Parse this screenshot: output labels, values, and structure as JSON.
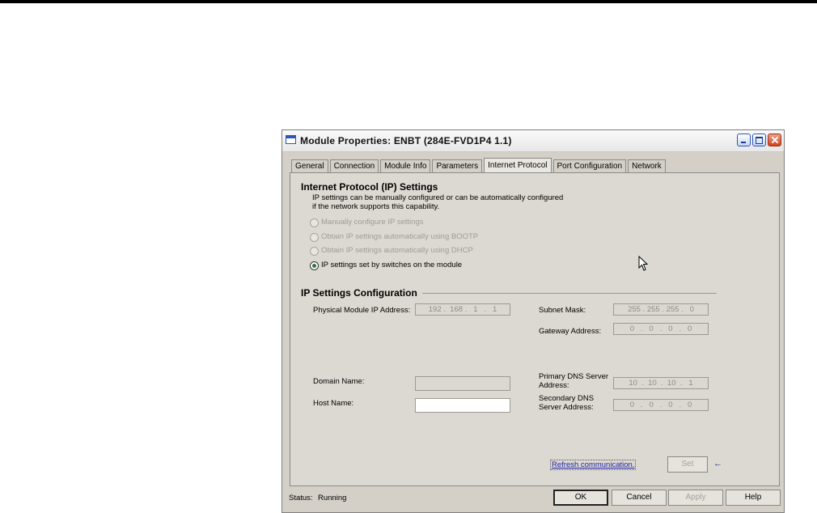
{
  "window": {
    "title": "Module Properties: ENBT (284E-FVD1P4 1.1)"
  },
  "tabs": [
    "General",
    "Connection",
    "Module Info",
    "Parameters",
    "Internet Protocol",
    "Port Configuration",
    "Network"
  ],
  "active_tab": "Internet Protocol",
  "ip_settings": {
    "heading": "Internet Protocol (IP) Settings",
    "desc_line1": "IP settings can be manually configured or can be automatically configured",
    "desc_line2": "if the network supports this capability.",
    "options": [
      {
        "label": "Manually configure IP settings",
        "selected": false,
        "enabled": false
      },
      {
        "label": "Obtain IP settings automatically using BOOTP",
        "selected": false,
        "enabled": false
      },
      {
        "label": "Obtain IP settings automatically using DHCP",
        "selected": false,
        "enabled": false
      },
      {
        "label": "IP settings set by switches on the module",
        "selected": true,
        "enabled": true
      }
    ]
  },
  "config": {
    "heading": "IP Settings Configuration",
    "ip_label": "Physical Module IP Address:",
    "ip_value": "192 .  168 .   1   .   1",
    "subnet_label": "Subnet Mask:",
    "subnet_value": "255 . 255 . 255 .   0",
    "gateway_label": "Gateway Address:",
    "gateway_value": "0   .   0   .   0   .   0",
    "domain_label": "Domain Name:",
    "domain_value": "",
    "host_label": "Host Name:",
    "host_value": "",
    "primary_dns_label_1": "Primary DNS Server",
    "primary_dns_label_2": "Address:",
    "primary_dns_value": "10  .  10  .  10  .   1",
    "secondary_dns_label_1": "Secondary DNS",
    "secondary_dns_label_2": "Server Address:",
    "secondary_dns_value": "0   .   0   .   0   .   0"
  },
  "actions": {
    "refresh": "Refresh communication.",
    "set": "Set"
  },
  "status": {
    "label": "Status:",
    "value": "Running"
  },
  "buttons": {
    "ok": "OK",
    "cancel": "Cancel",
    "apply": "Apply",
    "help": "Help"
  }
}
